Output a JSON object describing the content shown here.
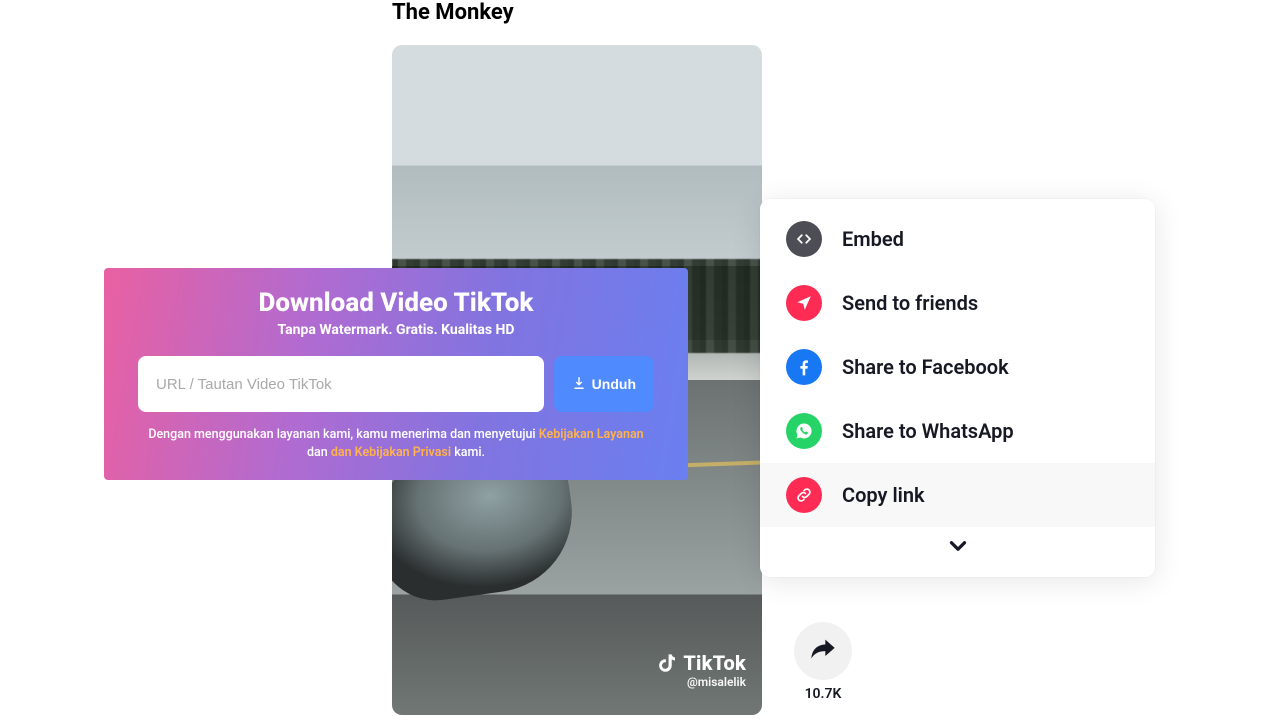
{
  "page": {
    "title": "The Monkey"
  },
  "video": {
    "brand": "TikTok",
    "handle": "@misalelik"
  },
  "action": {
    "share_count": "10.7K"
  },
  "share": {
    "items": [
      {
        "label": "Embed"
      },
      {
        "label": "Send to friends"
      },
      {
        "label": "Share to Facebook"
      },
      {
        "label": "Share to WhatsApp"
      },
      {
        "label": "Copy link"
      }
    ]
  },
  "downloader": {
    "title": "Download Video TikTok",
    "subtitle": "Tanpa Watermark. Gratis. Kualitas HD",
    "placeholder": "URL / Tautan Video TikTok",
    "button": "Unduh",
    "terms_pre": "Dengan menggunakan layanan kami, kamu menerima dan menyetujui ",
    "terms_link1": "Kebijakan Layanan",
    "terms_mid": " dan ",
    "terms_link2": "dan Kebijakan Privasi",
    "terms_post": " kami."
  }
}
